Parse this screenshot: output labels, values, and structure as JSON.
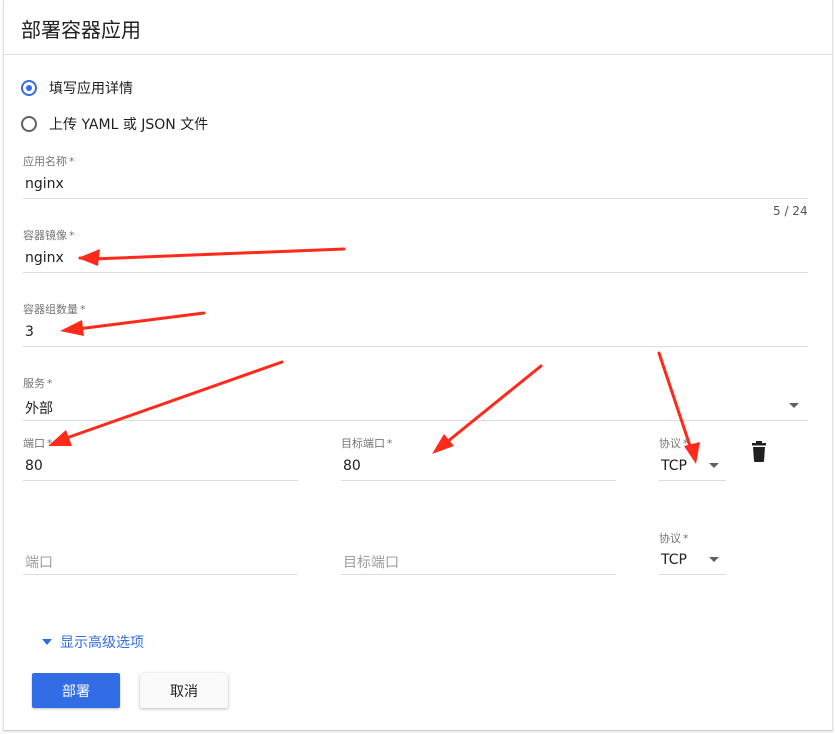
{
  "header": {
    "title": "部署容器应用"
  },
  "mode": {
    "option_fill": "填写应用详情",
    "option_upload": "上传 YAML 或 JSON 文件",
    "selected": "option_fill"
  },
  "app_name": {
    "label": "应用名称",
    "required_mark": "*",
    "value": "nginx",
    "counter": "5 / 24"
  },
  "image": {
    "label": "容器镜像",
    "required_mark": "*",
    "value": "nginx"
  },
  "pods": {
    "label": "容器组数量",
    "required_mark": "*",
    "value": "3"
  },
  "service": {
    "label": "服务",
    "required_mark": "*",
    "value": "外部"
  },
  "port_rows": [
    {
      "port_label": "端口",
      "port_required_mark": "*",
      "port_value": "80",
      "target_label": "目标端口",
      "target_required_mark": "*",
      "target_value": "80",
      "protocol_label": "协议",
      "protocol_required_mark": "*",
      "protocol_value": "TCP"
    },
    {
      "port_placeholder": "端口",
      "target_placeholder": "目标端口",
      "protocol_label": "协议",
      "protocol_required_mark": "*",
      "protocol_value": "TCP"
    }
  ],
  "advanced_toggle": "显示高级选项",
  "actions": {
    "deploy": "部署",
    "cancel": "取消"
  },
  "colors": {
    "accent": "#326de6",
    "annotation_arrow": "#ff2a1a"
  },
  "icons": {
    "delete": "trash-icon",
    "dropdown": "caret-down-icon",
    "expand": "triangle-down-icon"
  }
}
